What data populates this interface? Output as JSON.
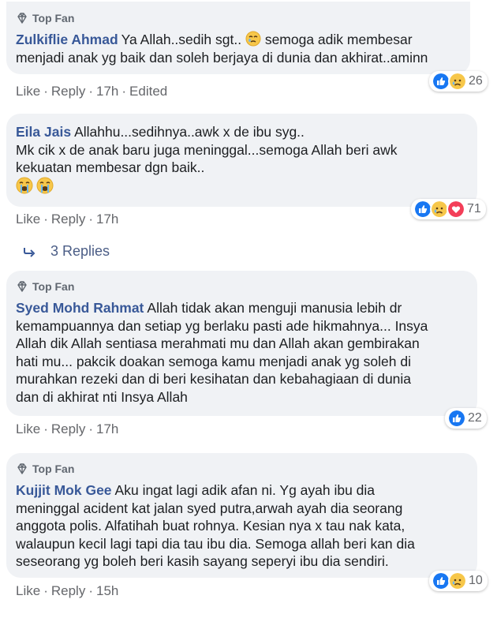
{
  "comments": [
    {
      "badge": "Top Fan",
      "author": "Zulkiflie Ahmad",
      "lines": [
        "Ya Allah..sedih sgt..",
        " semoga adik membesar",
        "menjadi anak yg baik dan soleh berjaya di dunia dan akhirat..aminn"
      ],
      "like": "Like",
      "reply": "Reply",
      "time": "17h",
      "edited": "Edited",
      "reaction_count": "26"
    },
    {
      "author": "Eila Jais",
      "lines": [
        "Allahhu...sedihnya..awk x de ibu syg..",
        "Mk cik x de anak baru juga meninggal...semoga Allah beri awk",
        "kekuatan membesar dgn baik.."
      ],
      "like": "Like",
      "reply": "Reply",
      "time": "17h",
      "reaction_count": "71"
    },
    {
      "badge": "Top Fan",
      "author": "Syed Mohd Rahmat",
      "lines": [
        "Allah tidak akan menguji manusia lebih dr",
        "kemampuannya dan setiap yg berlaku pasti ade hikmahnya... Insya",
        "Allah dik Allah sentiasa merahmati mu dan Allah akan gembirakan",
        "hati mu... pakcik doakan semoga kamu menjadi anak yg soleh di",
        "murahkan rezeki dan di beri kesihatan dan kebahagiaan di dunia",
        "dan di akhirat nti Insya Allah"
      ],
      "like": "Like",
      "reply": "Reply",
      "time": "17h",
      "reaction_count": "22"
    },
    {
      "badge": "Top Fan",
      "author": "Kujjit Mok Gee",
      "lines": [
        "Aku ingat lagi adik afan ni. Yg ayah ibu dia",
        "meninggal acident kat jalan syed putra,arwah ayah dia seorang",
        "anggota polis. Alfatihah buat rohnya. Kesian nya x tau nak kata,",
        "walaupun kecil lagi tapi dia tau ibu dia. Semoga allah beri kan dia",
        "seseorang yg boleh beri kasih sayang seperyi ibu dia sendiri."
      ],
      "like": "Like",
      "reply": "Reply",
      "time": "15h",
      "reaction_count": "10"
    }
  ],
  "replies_link": "3 Replies",
  "colors": {
    "author": "#385898",
    "bubble": "#f0f2f5",
    "meta": "#65676b",
    "like_blue": "#1877f2"
  }
}
